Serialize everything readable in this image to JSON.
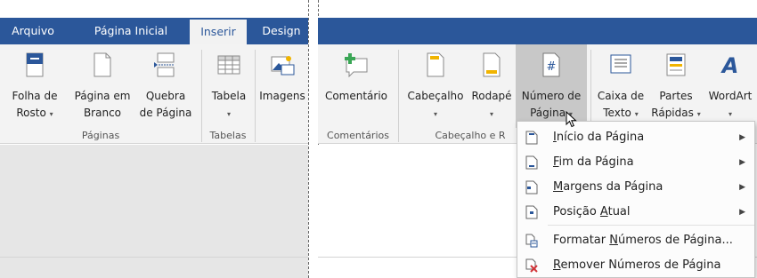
{
  "tabs": {
    "arquivo": "Arquivo",
    "pagina_inicial": "Página Inicial",
    "inserir": "Inserir",
    "design": "Design"
  },
  "ribbon": {
    "folha": {
      "l1": "Folha de",
      "l2": "Rosto"
    },
    "pagina_branco": {
      "l1": "Página em",
      "l2": "Branco"
    },
    "quebra": {
      "l1": "Quebra",
      "l2": "de Página"
    },
    "tabela": {
      "l1": "Tabela"
    },
    "imagens": {
      "l1": "Imagens"
    },
    "comentario": {
      "l1": "Comentário"
    },
    "cabecalho": {
      "l1": "Cabeçalho"
    },
    "rodape": {
      "l1": "Rodapé"
    },
    "numero": {
      "l1": "Número de",
      "l2": "Página"
    },
    "caixa": {
      "l1": "Caixa de",
      "l2": "Texto"
    },
    "partes": {
      "l1": "Partes",
      "l2": "Rápidas"
    },
    "wordart": {
      "l1": "WordArt"
    }
  },
  "groups": {
    "paginas": "Páginas",
    "tabelas": "Tabelas",
    "comentarios": "Comentários",
    "cabecalho": "Cabeçalho e R"
  },
  "caret": "▾",
  "menu": {
    "items": [
      {
        "pre": "",
        "key": "I",
        "post": "nício da Página"
      },
      {
        "pre": "",
        "key": "F",
        "post": "im da Página"
      },
      {
        "pre": "",
        "key": "M",
        "post": "argens da Página"
      },
      {
        "pre": "Posição ",
        "key": "A",
        "post": "tual"
      },
      {
        "pre": "Formatar ",
        "key": "N",
        "post": "úmeros de Página..."
      },
      {
        "pre": "",
        "key": "R",
        "post": "emover Números de Página"
      }
    ]
  },
  "icons": {
    "hash": "#"
  },
  "colors": {
    "titlebar": "#2b579a",
    "ribbon": "#f3f3f3",
    "accent_red": "#d13438",
    "accent_green": "#3aa655"
  }
}
